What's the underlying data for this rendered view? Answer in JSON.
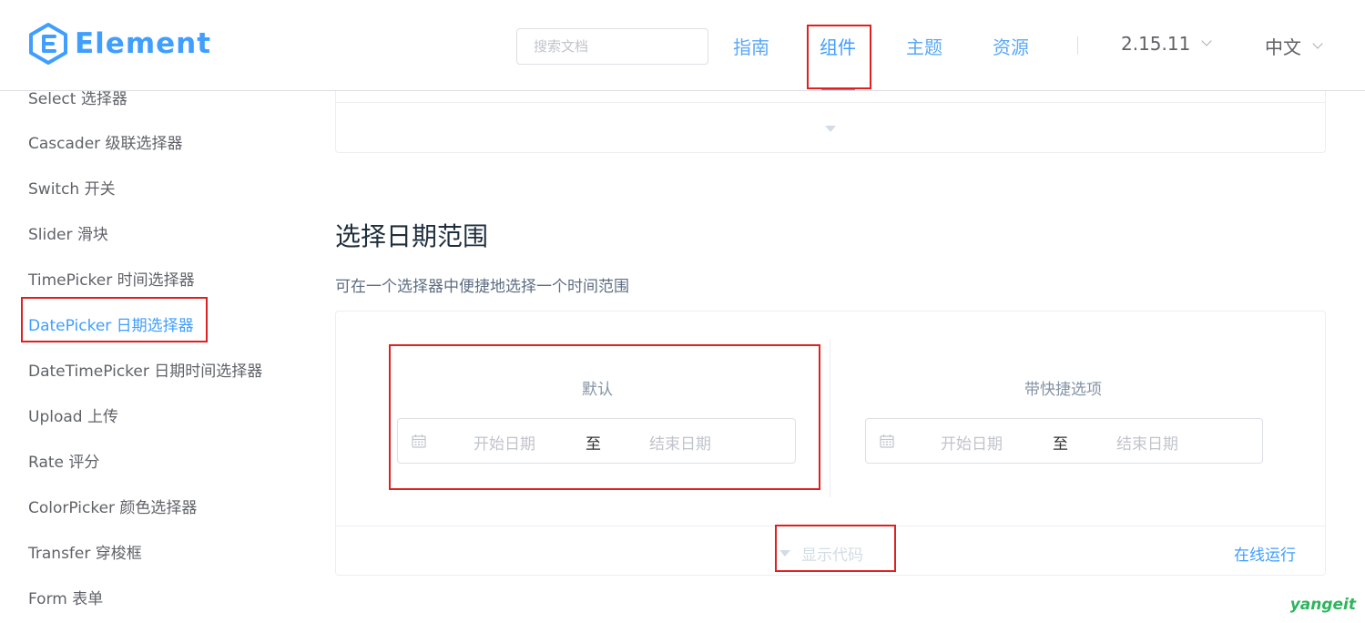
{
  "header": {
    "logo_text": "Element",
    "search_placeholder": "搜索文档",
    "nav": [
      "指南",
      "组件",
      "主题",
      "资源"
    ],
    "version": "2.15.11",
    "language": "中文"
  },
  "sidebar": {
    "items": [
      "Select 选择器",
      "Cascader 级联选择器",
      "Switch 开关",
      "Slider 滑块",
      "TimePicker 时间选择器",
      "DatePicker 日期选择器",
      "DateTimePicker 日期时间选择器",
      "Upload 上传",
      "Rate 评分",
      "ColorPicker 颜色选择器",
      "Transfer 穿梭框",
      "Form 表单"
    ],
    "active": "DatePicker 日期选择器"
  },
  "section": {
    "title": "选择日期范围",
    "description": "可在一个选择器中便捷地选择一个时间范围"
  },
  "demo": {
    "left": {
      "label": "默认",
      "start_placeholder": "开始日期",
      "separator": "至",
      "end_placeholder": "结束日期"
    },
    "right": {
      "label": "带快捷选项",
      "start_placeholder": "开始日期",
      "separator": "至",
      "end_placeholder": "结束日期"
    },
    "show_code": "显示代码",
    "run_online": "在线运行"
  },
  "watermark": "yangeit",
  "colors": {
    "primary": "#409eff",
    "highlight_box": "#e02020"
  }
}
